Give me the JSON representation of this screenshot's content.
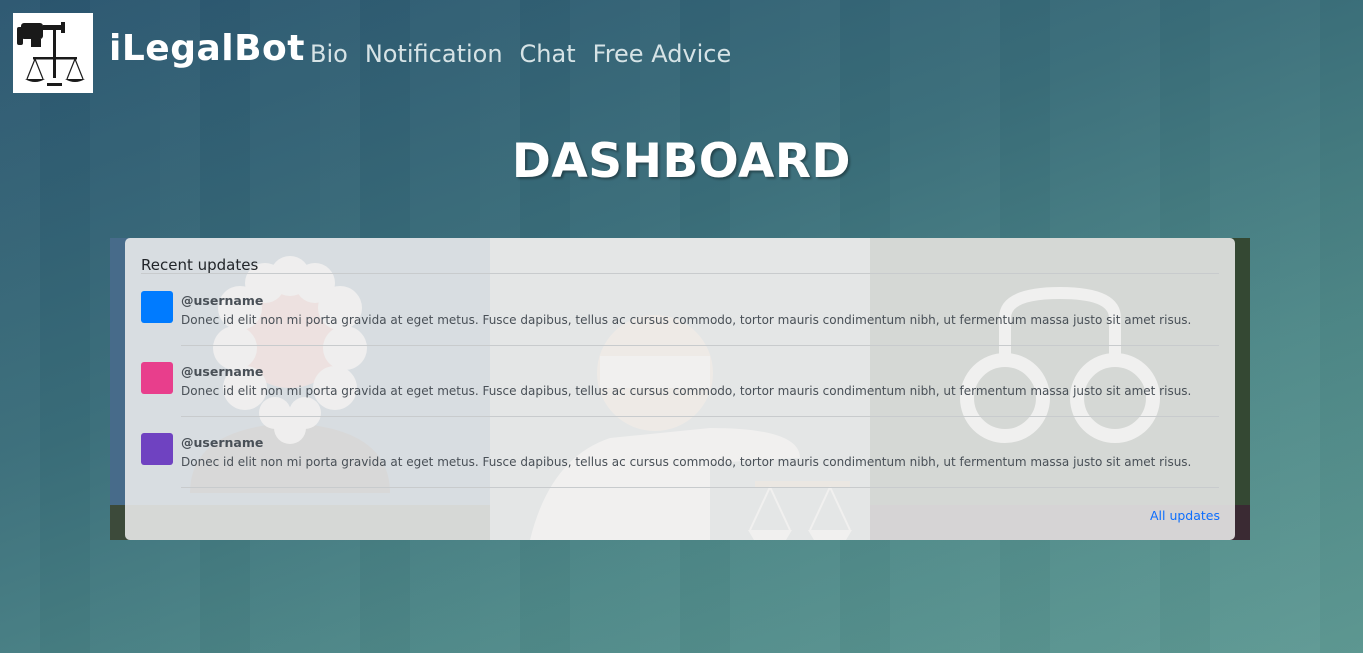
{
  "brand": {
    "name": "iLegalBot"
  },
  "nav": {
    "items": [
      "Bio",
      "Notification",
      "Chat",
      "Free Advice"
    ]
  },
  "page": {
    "title": "DASHBOARD"
  },
  "updates": {
    "title": "Recent updates",
    "items": [
      {
        "username": "@username",
        "message": "Donec id elit non mi porta gravida at eget metus. Fusce dapibus, tellus ac cursus commodo, tortor mauris condimentum nibh, ut fermentum massa justo sit amet risus.",
        "color": "#007bff"
      },
      {
        "username": "@username",
        "message": "Donec id elit non mi porta gravida at eget metus. Fusce dapibus, tellus ac cursus commodo, tortor mauris condimentum nibh, ut fermentum massa justo sit amet risus.",
        "color": "#e83e8c"
      },
      {
        "username": "@username",
        "message": "Donec id elit non mi porta gravida at eget metus. Fusce dapibus, tellus ac cursus commodo, tortor mauris condimentum nibh, ut fermentum massa justo sit amet risus.",
        "color": "#6f42c1"
      }
    ],
    "all_link": "All updates"
  },
  "colors": {
    "link": "#0d6efd",
    "text_muted": "#495057"
  },
  "icons": {
    "logo": "gavel-scales-icon",
    "banner": [
      "judge-icon",
      "lady-justice-icon",
      "handcuffs-icon"
    ]
  }
}
